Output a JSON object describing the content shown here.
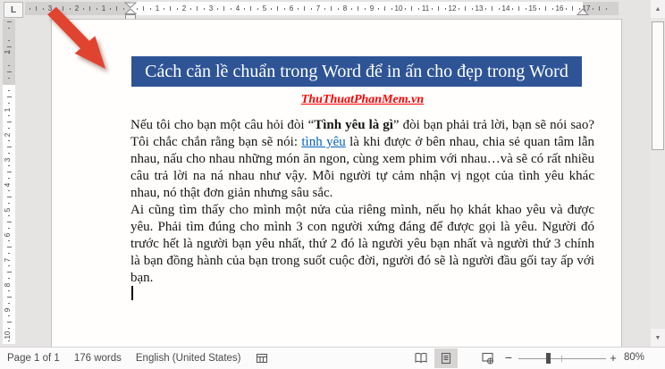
{
  "ruler": {
    "tab_selector": "L",
    "h_numbers_left": [
      "1",
      "2",
      "3"
    ],
    "h_numbers_right": [
      "1",
      "2",
      "3",
      "4",
      "5",
      "6",
      "7",
      "8",
      "9",
      "10",
      "11",
      "12",
      "13",
      "14",
      "15",
      "16",
      "17"
    ],
    "v_number_top": "1",
    "v_numbers": [
      "1",
      "2",
      "3",
      "4",
      "5",
      "6",
      "7",
      "8",
      "9",
      "10"
    ]
  },
  "document": {
    "title": "Cách căn lề chuẩn trong Word để in ấn cho đẹp trong Word",
    "link_line": "ThuThuatPhanMem.vn",
    "paragraph1": {
      "seg1": "Nếu tôi cho bạn một câu hỏi đòi “",
      "bold": "Tình yêu là gì",
      "seg2": "” đòi bạn phải trả lời, bạn sẽ nói sao? Tôi chắc chắn rằng bạn sẽ nói: ",
      "link": "tình yêu",
      "seg3": " là khi được ở bên nhau, chia sẻ quan tâm lẫn nhau, nấu cho nhau những món ăn ngon, cùng xem phim với nhau…và sẽ có rất nhiều câu trả lời na ná nhau như vậy. Mỗi người tự cảm nhận vị ngọt của tình yêu khác nhau, nó thật đơn giản nhưng sâu sắc."
    },
    "paragraph2": "Ai cũng tìm thấy cho mình một nửa của riêng mình, nếu họ khát khao yêu và được yêu. Phải tìm đúng cho mình 3 con người xứng đáng để được gọi là yêu. Người đó trước hết là người bạn yêu  nhất, thứ 2 đó là người yêu bạn  nhất và người thứ 3 chính là bạn đồng hành của bạn trong suốt cuộc đời, người đó sẽ là người đầu gối tay ấp với bạn."
  },
  "status_bar": {
    "page_indicator": "Page 1 of 1",
    "word_count": "176 words",
    "language": "English (United States)",
    "zoom_out": "−",
    "zoom_in": "+",
    "zoom_level": "80%"
  },
  "icons": {
    "left_status": "macro-record-icon",
    "view_buttons": [
      "read-mode-icon",
      "print-layout-icon",
      "web-layout-icon"
    ],
    "scroll": [
      "scroll-up-icon",
      "scroll-down-icon"
    ],
    "annotation": "red-arrow-annotation"
  },
  "colors": {
    "title_bg": "#2E5496",
    "title_text": "#FFFFFF",
    "site_link_red": "#FF0000",
    "hyperlink_blue": "#0563C1",
    "arrow_red": "#E04431",
    "canvas_gray": "#E6E3E3"
  }
}
